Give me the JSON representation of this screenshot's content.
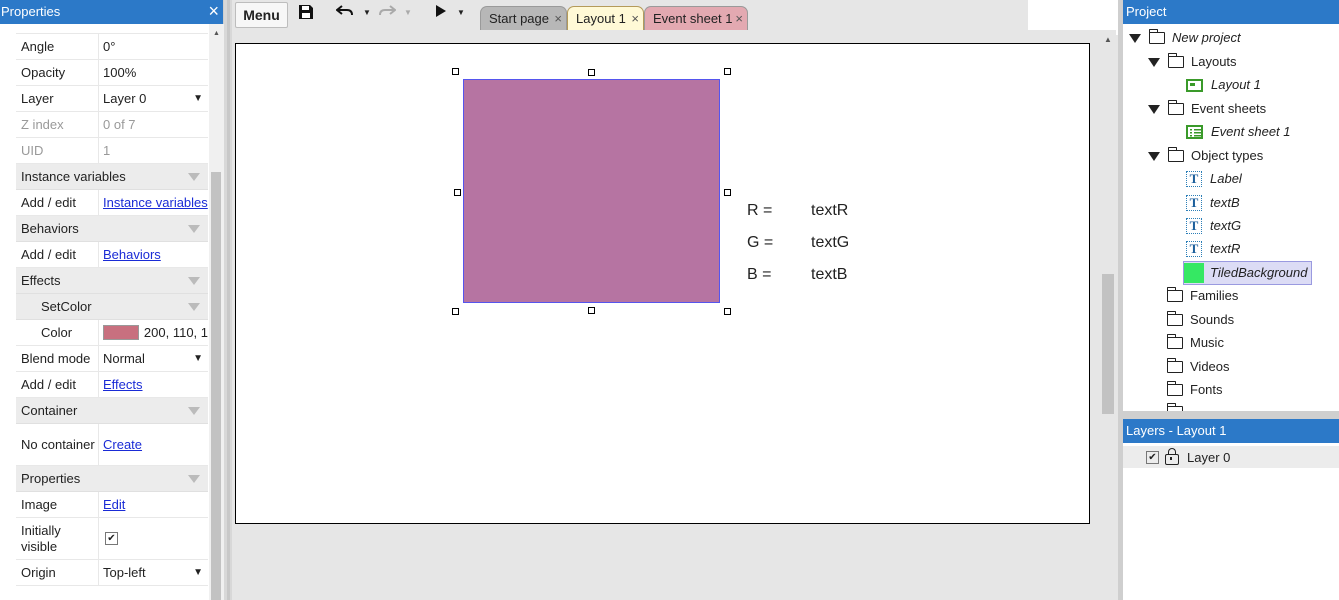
{
  "properties_panel": {
    "title": "Properties",
    "close_icon": "×",
    "rows": [
      {
        "key": "Angle",
        "value": "0°"
      },
      {
        "key": "Opacity",
        "value": "100%"
      },
      {
        "key": "Layer",
        "value": "Layer 0"
      },
      {
        "key": "Z index",
        "value": "0 of 7"
      },
      {
        "key": "UID",
        "value": "1"
      }
    ],
    "groups": {
      "instance_variables": "Instance variables",
      "behaviors": "Behaviors",
      "effects": "Effects",
      "setcolor": "SetColor",
      "container": "Container",
      "properties": "Properties"
    },
    "add_edit": "Add / edit",
    "instance_variables_link": "Instance variables",
    "behaviors_link": "Behaviors",
    "effects_link": "Effects",
    "color_key": "Color",
    "color_value": "200, 110, 1",
    "color_swatch": "#c8707f",
    "blend_key": "Blend mode",
    "blend_value": "Normal",
    "container_key": "No container",
    "container_link": "Create",
    "image_key": "Image",
    "image_link": "Edit",
    "visible_key": "Initially visible",
    "visible_checked": "✔",
    "origin_key": "Origin",
    "origin_value": "Top-left"
  },
  "toolbar": {
    "menu_label": "Menu",
    "save_icon": "floppy-disk-icon",
    "undo_icon": "undo-icon",
    "redo_icon": "redo-icon",
    "play_icon": "play-icon",
    "tabs": [
      {
        "label": "Start page",
        "close": "×"
      },
      {
        "label": "Layout 1",
        "close": "×"
      },
      {
        "label": "Event sheet 1",
        "close": "×"
      }
    ]
  },
  "layout": {
    "tiled_background_color": "#b674a2",
    "labels": {
      "r_label": "R =",
      "g_label": "G =",
      "b_label": "B =",
      "r_text": "textR",
      "g_text": "textG",
      "b_text": "textB"
    }
  },
  "project_panel": {
    "title": "Project",
    "tree": {
      "root": "New project",
      "layouts": "Layouts",
      "layout1": "Layout 1",
      "event_sheets": "Event sheets",
      "event_sheet1": "Event sheet 1",
      "object_types": "Object types",
      "label_obj": "Label",
      "textB": "textB",
      "textG": "textG",
      "textR": "textR",
      "tiled": "TiledBackground",
      "families": "Families",
      "sounds": "Sounds",
      "music": "Music",
      "videos": "Videos",
      "fonts": "Fonts"
    }
  },
  "layers_panel": {
    "title": "Layers - Layout 1",
    "layer_name": "Layer 0",
    "layer_checked": "✔"
  }
}
